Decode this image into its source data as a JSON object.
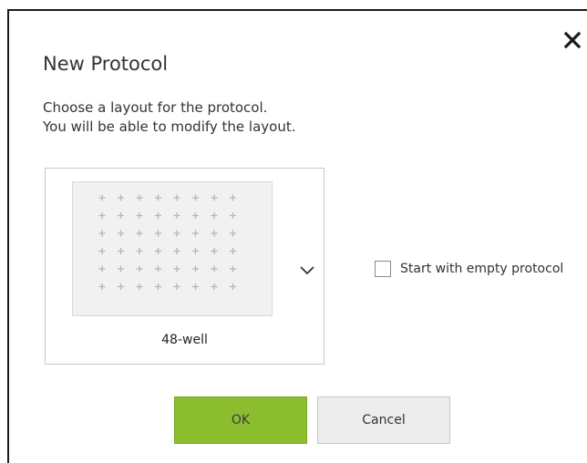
{
  "dialog": {
    "title": "New Protocol",
    "description_line1": "Choose a layout for the protocol.",
    "description_line2": "You will be able to modify the layout.",
    "close_icon": "close-icon"
  },
  "layout_selector": {
    "selected_layout": "48-well",
    "wells": {
      "rows": 6,
      "columns": 8
    },
    "dropdown_icon": "chevron-down-icon"
  },
  "option": {
    "empty_protocol_label": "Start with empty protocol",
    "checked": false
  },
  "buttons": {
    "ok_label": "OK",
    "cancel_label": "Cancel"
  },
  "colors": {
    "ok_green": "#8cbd2f",
    "plate_bg": "#f1f1f1",
    "well_marker": "#b5b5b5"
  }
}
